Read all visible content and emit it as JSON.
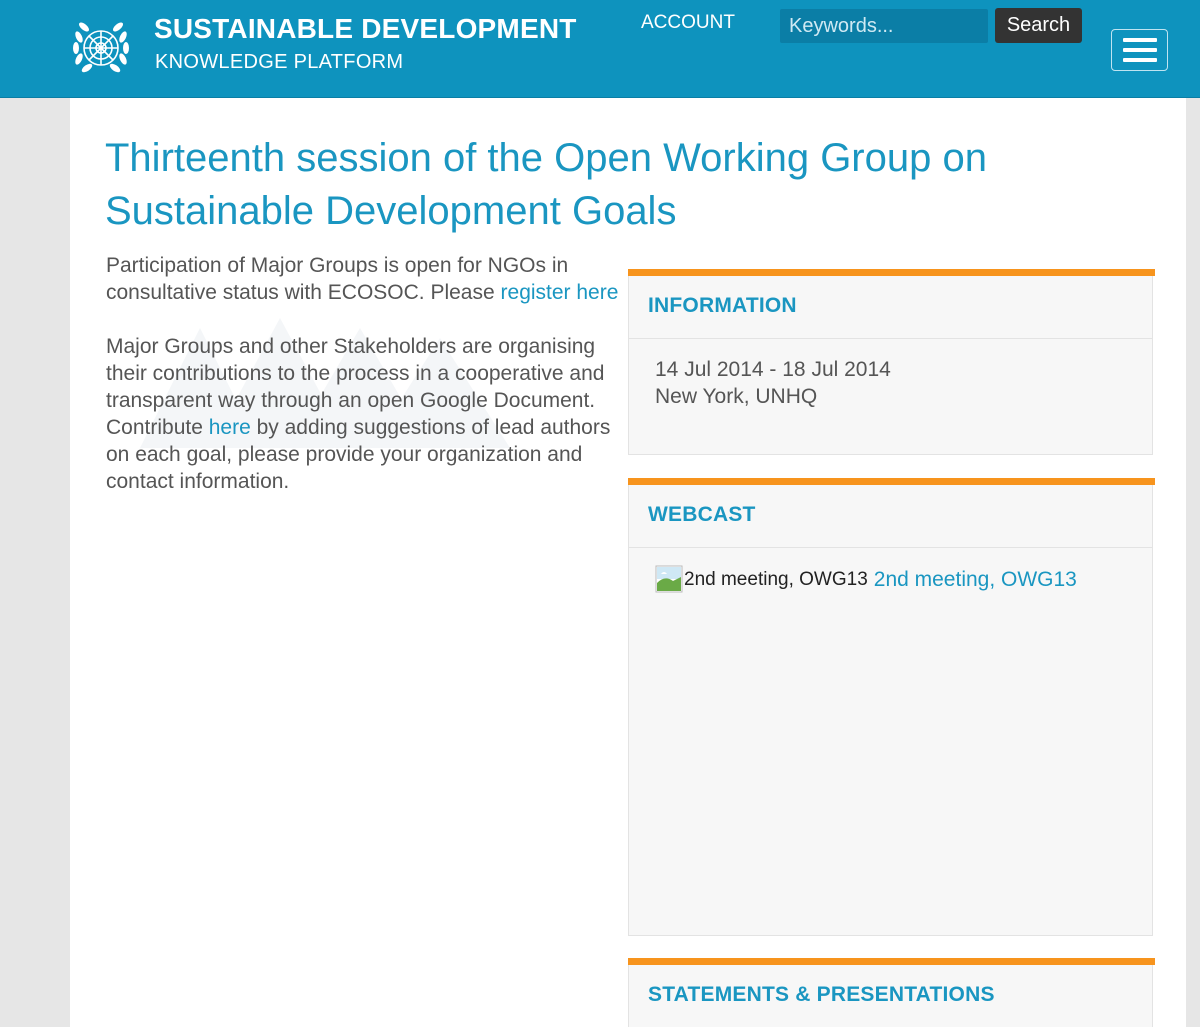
{
  "header": {
    "title": "SUSTAINABLE DEVELOPMENT",
    "subtitle": "KNOWLEDGE PLATFORM",
    "account_label": "ACCOUNT",
    "search_placeholder": "Keywords...",
    "search_button_label": "Search",
    "logo_icon": "un-emblem-icon",
    "menu_icon": "hamburger-menu-icon"
  },
  "page": {
    "title": "Thirteenth session of the Open Working Group on Sustainable Development Goals",
    "intro_1_text": "Participation of Major Groups is open for NGOs in consultative status with ECOSOC. Please",
    "intro_1_link": "register here",
    "intro_2_before": "Major Groups and other Stakeholders are organising their contributions to the process in a cooperative and transparent way through an open Google Document. Contribute",
    "intro_2_link": "here",
    "intro_2_after": "by adding suggestions of lead authors on each goal, please provide your organization and contact information."
  },
  "information": {
    "heading": "INFORMATION",
    "dates": "14 Jul 2014 - 18 Jul 2014",
    "location": "New York, UNHQ"
  },
  "webcast": {
    "heading": "WEBCAST",
    "image_alt": "2nd meeting, OWG13",
    "link_label": "2nd meeting, OWG13"
  },
  "statements": {
    "heading": "STATEMENTS & PRESENTATIONS"
  },
  "colors": {
    "header_bg": "#0e93be",
    "accent_blue": "#1a96c1",
    "accent_orange": "#f7941d",
    "page_bg": "#e6e6e6"
  }
}
